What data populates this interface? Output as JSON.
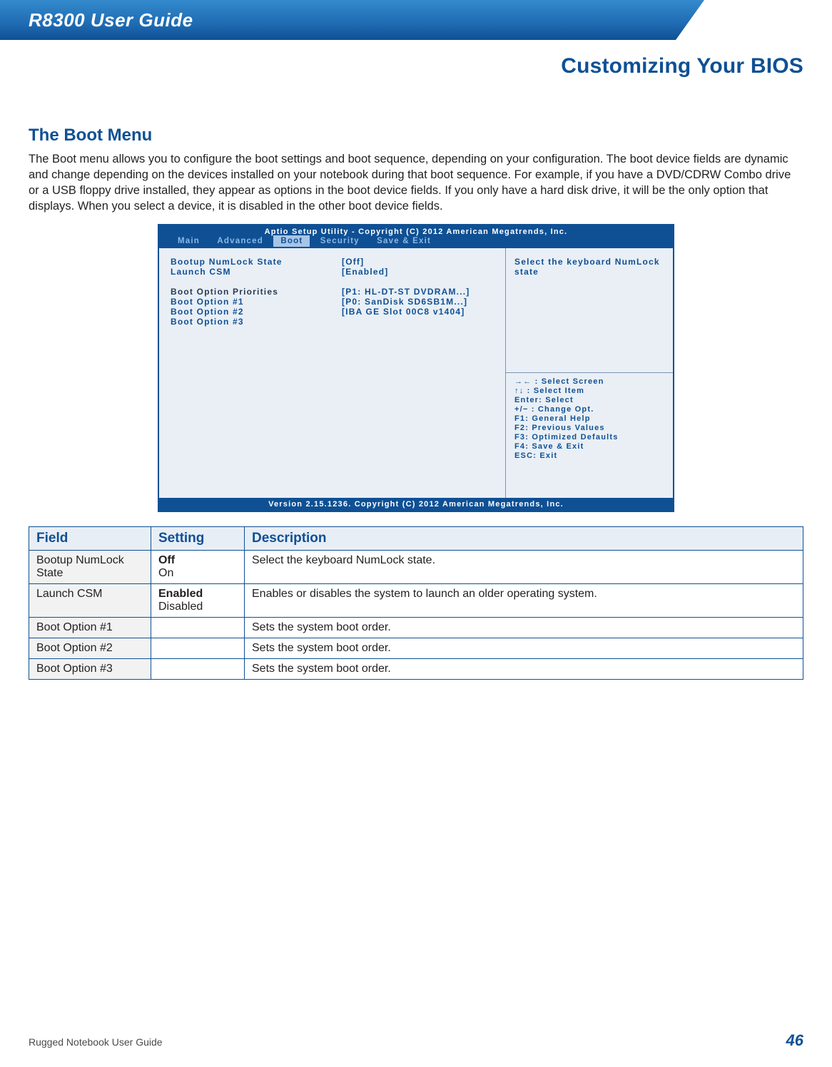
{
  "header": {
    "title": "R8300 User Guide"
  },
  "chapter": "Customizing Your BIOS",
  "section": {
    "heading": "The Boot Menu",
    "body": "The Boot menu allows you to configure the boot settings and boot sequence, depending on your configuration. The boot device fields are dynamic and change depending on the devices installed on your notebook during that boot sequence. For example, if you have a DVD/CDRW Combo drive or a USB floppy drive installed, they appear as options in the boot device fields. If you only have a hard disk drive, it will be the only option that displays. When you select a device, it is disabled in the other boot device fields."
  },
  "bios": {
    "title": "Aptio Setup Utility - Copyright (C) 2012 American Megatrends, Inc.",
    "tabs": [
      "Main",
      "Advanced",
      "Boot",
      "Security",
      "Save & Exit"
    ],
    "active_tab": "Boot",
    "rows": [
      {
        "label": "Bootup NumLock State",
        "value": "[Off]",
        "hl": true
      },
      {
        "label": "Launch CSM",
        "value": "[Enabled]",
        "hl": true
      }
    ],
    "group_label": "Boot Option Priorities",
    "opts": [
      {
        "label": "Boot Option #1",
        "value": "[P1: HL-DT-ST DVDRAM...]"
      },
      {
        "label": "Boot Option #2",
        "value": "[P0: SanDisk SD6SB1M...]"
      },
      {
        "label": "Boot Option #3",
        "value": "[IBA GE Slot 00C8 v1404]"
      }
    ],
    "help_top": "Select the keyboard NumLock state",
    "help": [
      "→← : Select Screen",
      "↑↓ : Select Item",
      "Enter: Select",
      "+/− : Change Opt.",
      "F1: General Help",
      "F2: Previous Values",
      "F3: Optimized Defaults",
      "F4: Save & Exit",
      "ESC: Exit"
    ],
    "footer": "Version 2.15.1236. Copyright (C) 2012 American Megatrends, Inc."
  },
  "table": {
    "headers": [
      "Field",
      "Setting",
      "Description"
    ],
    "rows": [
      {
        "field": "Bootup NumLock State",
        "setting_bold": "Off",
        "setting_plain": "On",
        "desc": "Select the keyboard NumLock state."
      },
      {
        "field": "Launch CSM",
        "setting_bold": "Enabled",
        "setting_plain": "Disabled",
        "desc": "Enables or disables the system to launch an older operating system."
      },
      {
        "field": "Boot Option #1",
        "setting_bold": "",
        "setting_plain": "",
        "desc": "Sets the system boot order."
      },
      {
        "field": "Boot Option #2",
        "setting_bold": "",
        "setting_plain": "",
        "desc": "Sets the system boot order."
      },
      {
        "field": "Boot Option #3",
        "setting_bold": "",
        "setting_plain": "",
        "desc": "Sets the system boot order."
      }
    ]
  },
  "footer": {
    "left": "Rugged Notebook User Guide",
    "page": "46"
  }
}
